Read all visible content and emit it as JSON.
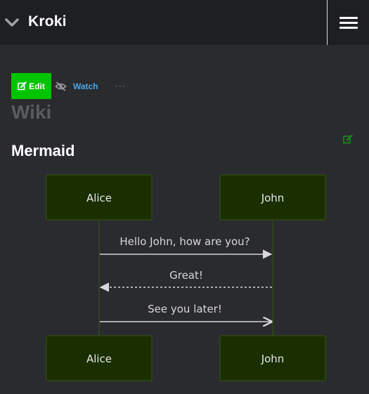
{
  "header": {
    "title": "Kroki",
    "menu_icon": "hamburger-icon",
    "collapse_icon": "chevron-down-icon"
  },
  "actions": {
    "edit_label": "Edit",
    "watch_label": "Watch",
    "more_label": "···"
  },
  "page": {
    "title": "Wiki"
  },
  "section": {
    "heading": "Mermaid"
  },
  "diagram": {
    "type": "sequence",
    "participants": {
      "alice": "Alice",
      "john": "John"
    },
    "messages": {
      "m1": "Hello John, how are you?",
      "m2": "Great!",
      "m3": "See you later!"
    }
  },
  "colors": {
    "accent_green": "#00c400",
    "link_blue": "#4aa8e8",
    "actor_fill": "#1a2e00",
    "actor_border": "#2f4a10"
  }
}
